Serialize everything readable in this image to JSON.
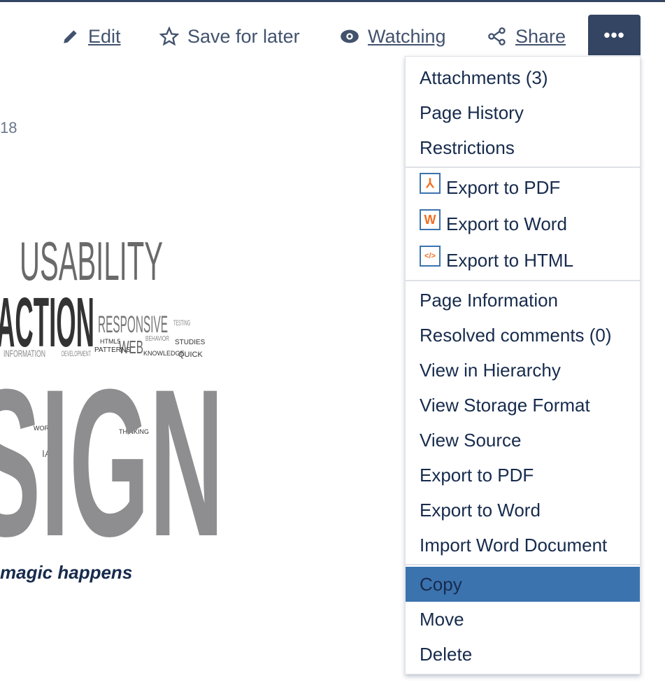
{
  "toolbar": {
    "edit": "Edit",
    "save": "Save for later",
    "watching": "Watching",
    "share": "Share",
    "more": "•••"
  },
  "page": {
    "date_fragment": "18",
    "caption": "magic happens"
  },
  "image": {
    "words": [
      "USABILITY",
      "ACTION",
      "RESPONSIVE",
      "WEB",
      "INFORMATION",
      "SIGN",
      "PATTERNS",
      "KNOWLEDGE",
      "STUDIES",
      "QUICK",
      "TESTING",
      "THINKING",
      "WORK",
      "IA",
      "DEVELOPMENT",
      "HTML5",
      "BEHAVIOR"
    ]
  },
  "menu": {
    "group1": [
      "Attachments (3)",
      "Page History",
      "Restrictions"
    ],
    "group2": [
      {
        "label": "Export to PDF",
        "icon": "pdf-icon"
      },
      {
        "label": "Export to Word",
        "icon": "word-icon"
      },
      {
        "label": "Export to HTML",
        "icon": "html-icon"
      }
    ],
    "group3": [
      "Page Information",
      "Resolved comments (0)",
      "View in Hierarchy",
      "View Storage Format",
      "View Source",
      "Export to PDF",
      "Export to Word",
      "Import Word Document"
    ],
    "group4": [
      "Copy",
      "Move",
      "Delete"
    ],
    "highlighted": "Copy",
    "highlight_color": "#3b73af"
  }
}
